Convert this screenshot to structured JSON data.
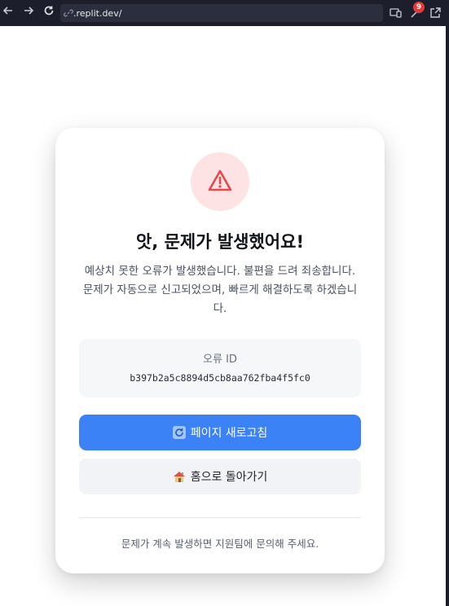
{
  "browser": {
    "url_prefix": "·",
    "url": ".replit.dev/",
    "notification_count": "9"
  },
  "error": {
    "title": "앗, 문제가 발생했어요!",
    "description": "예상치 못한 오류가 발생했습니다. 불편을 드려 죄송합니다. 문제가 자동으로 신고되었으며, 빠르게 해결하도록 하겠습니다.",
    "id_label": "오류 ID",
    "id_value": "b397b2a5c8894d5cb8aa762fba4f5fc0"
  },
  "actions": {
    "refresh_label": "페이지 새로고침",
    "home_label": "홈으로 돌아가기"
  },
  "footer": {
    "help_text": "문제가 계속 발생하면 지원팀에 문의해 주세요."
  },
  "colors": {
    "primary": "#3b82f6",
    "warning": "#e5484d",
    "warning_bg": "#fde3e3"
  }
}
